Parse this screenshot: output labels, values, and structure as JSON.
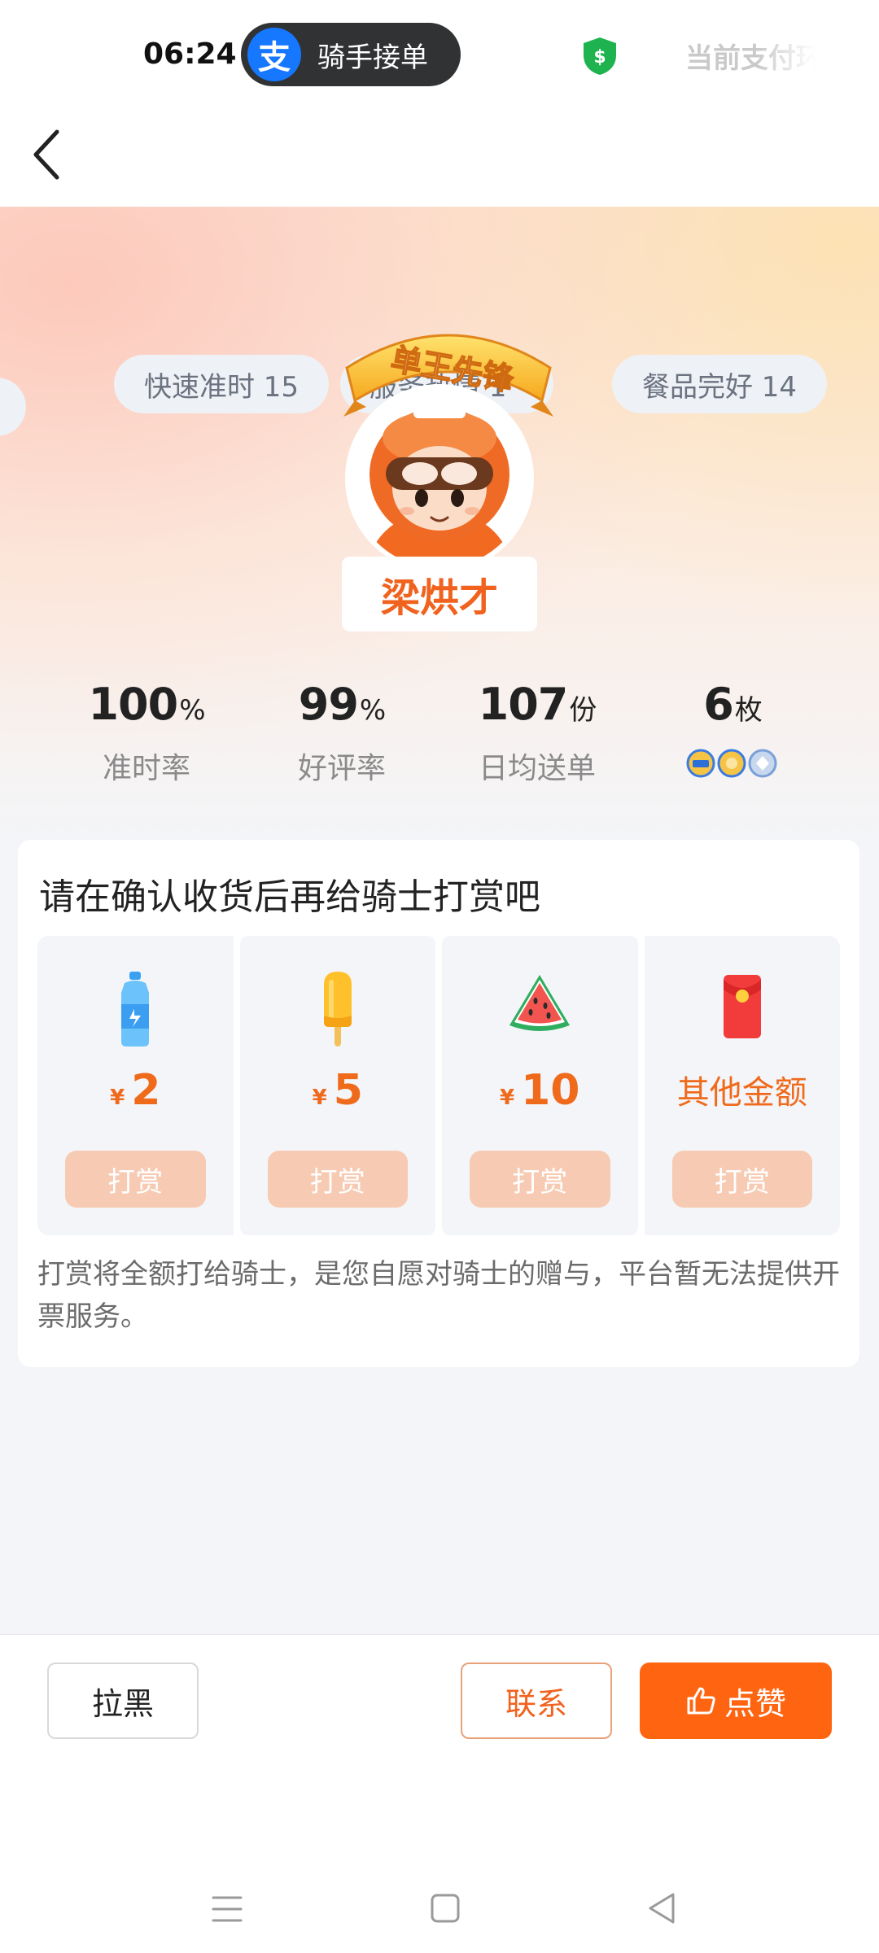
{
  "status_bar": {
    "time": "06:24",
    "app_pill": "骑手接单",
    "alipay_logo": "支",
    "right_text": "当前支付环"
  },
  "hero": {
    "tags": [
      "快速准时 15",
      "服务热情 1",
      "餐品完好 14"
    ],
    "badge": "单王先锋",
    "rider_name": "梁烘才"
  },
  "stats": [
    {
      "value": "100",
      "unit": "%",
      "label": "准时率"
    },
    {
      "value": "99",
      "unit": "%",
      "label": "好评率"
    },
    {
      "value": "107",
      "unit": "份",
      "label": "日均送单"
    },
    {
      "value": "6",
      "unit": "枚",
      "label": ""
    }
  ],
  "tip_card": {
    "title": "请在确认收货后再给骑士打赏吧",
    "currency": "¥",
    "items": [
      {
        "icon": "water-bottle-icon",
        "amount": "2",
        "button": "打赏"
      },
      {
        "icon": "popsicle-icon",
        "amount": "5",
        "button": "打赏"
      },
      {
        "icon": "watermelon-icon",
        "amount": "10",
        "button": "打赏"
      },
      {
        "icon": "red-envelope-icon",
        "amount": "其他金额",
        "button": "打赏"
      }
    ],
    "note": "打赏将全额打给骑士，是您自愿对骑士的赠与，平台暂无法提供开票服务。"
  },
  "bottom_bar": {
    "block": "拉黑",
    "contact": "联系",
    "like": "点赞"
  },
  "colors": {
    "accent": "#ff6411",
    "tip_text": "#f06a1c",
    "tip_button": "#f7cbb3"
  }
}
